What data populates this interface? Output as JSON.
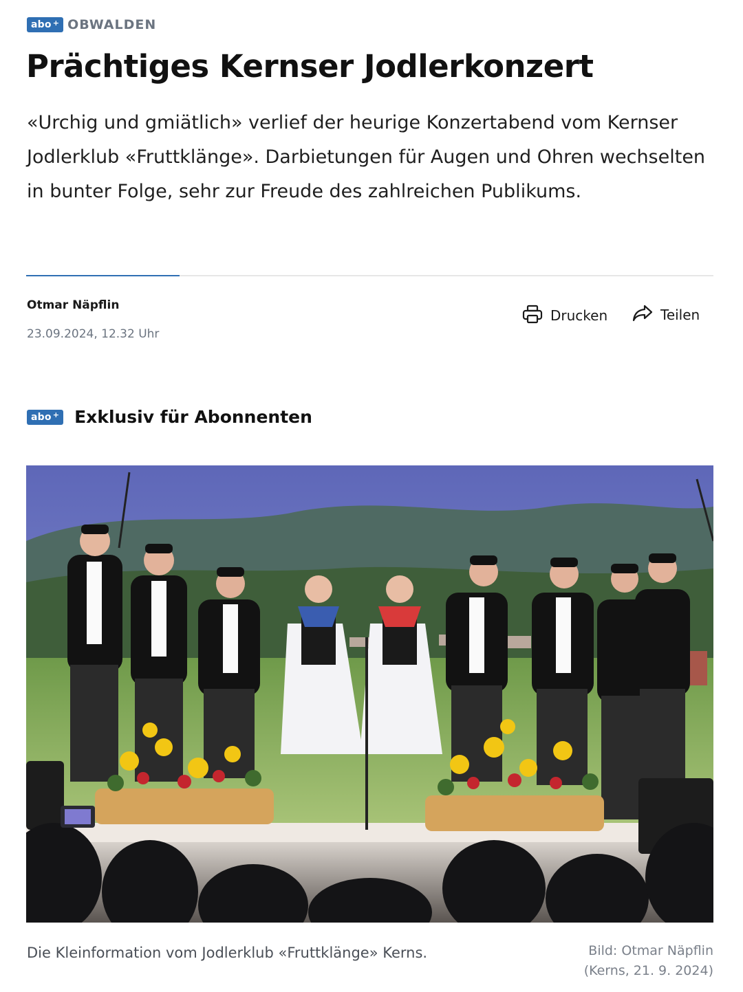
{
  "header": {
    "abo_badge": "abo",
    "abo_plus": "+",
    "kicker": "OBWALDEN"
  },
  "article": {
    "title": "Prächtiges Kernser Jodlerkonzert",
    "lead": "«Urchig und gmiätlich» verlief der heurige Konzertabend vom Kernser Jodlerklub «Fruttklänge». Darbietungen für Augen und Ohren wechselten in bunter Folge, sehr zur Freude des zahlreichen Publikums.",
    "author": "Otmar Näpflin",
    "date": "23.09.2024, 12.32 Uhr"
  },
  "actions": {
    "print_label": "Drucken",
    "print_icon": "printer-icon",
    "share_label": "Teilen",
    "share_icon": "share-arrow-icon"
  },
  "exclusive": {
    "badge": "abo",
    "badge_plus": "+",
    "title": "Exklusiv für Abonnenten"
  },
  "image": {
    "caption": "Die Kleinformation vom Jodlerklub «Fruttklänge» Kerns.",
    "credit_line1": "Bild: Otmar Näpflin",
    "credit_line2": "(Kerns, 21. 9. 2024)"
  },
  "colors": {
    "accent": "#2f6fb3",
    "text": "#1a1a1a",
    "muted": "#6b7480"
  }
}
